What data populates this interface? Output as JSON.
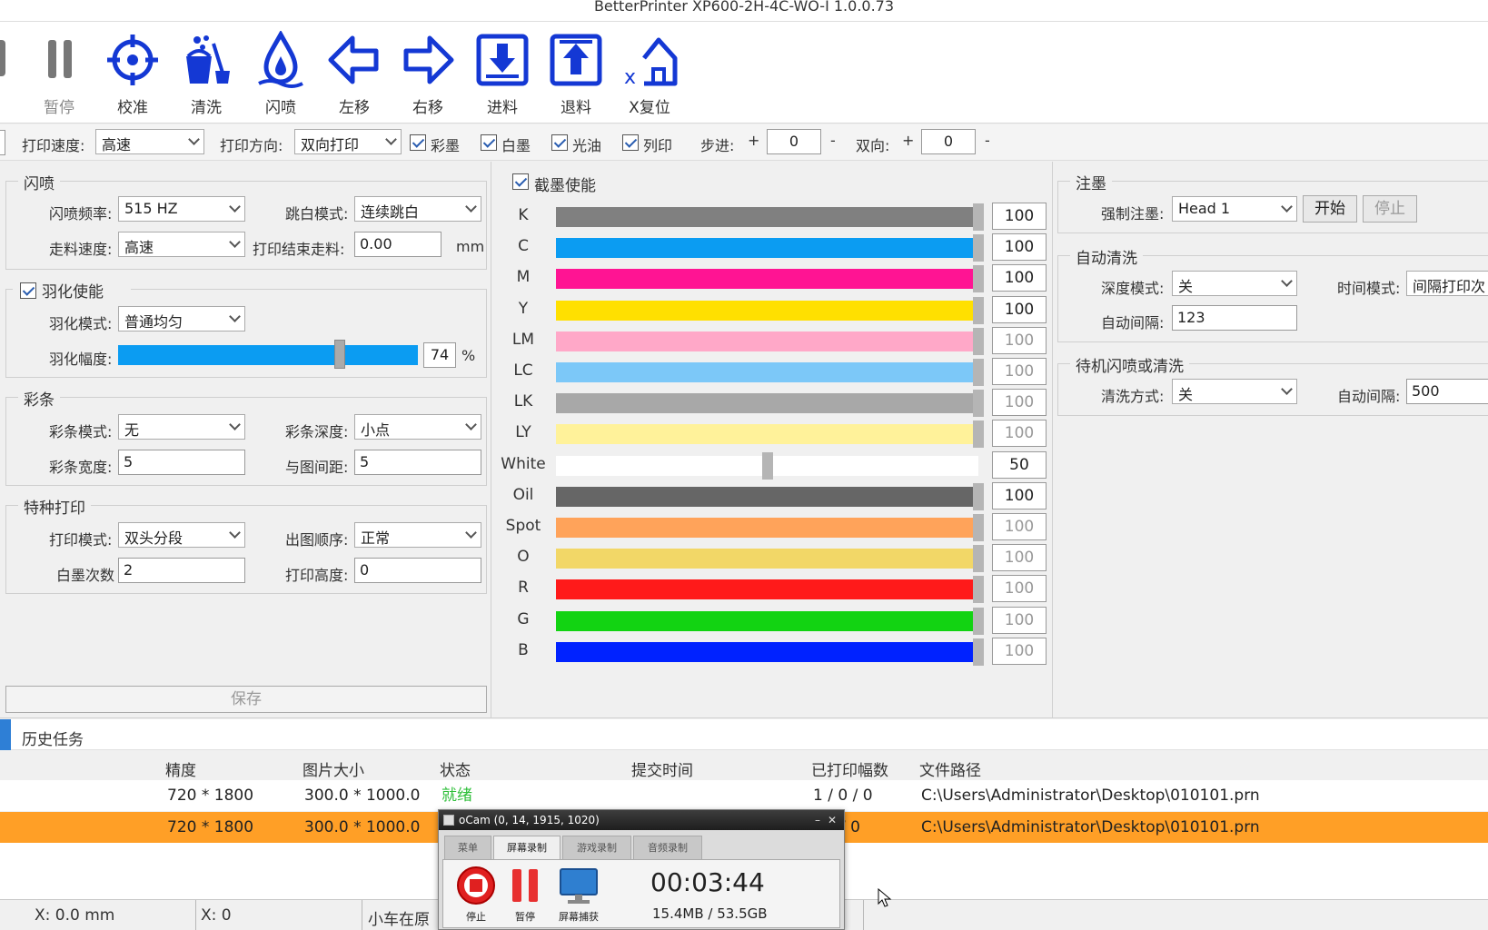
{
  "window": {
    "title": "BetterPrinter XP600-2H-4C-WO-I 1.0.0.73"
  },
  "toolbar": {
    "buttons": [
      {
        "label": "暂停",
        "icon": "pause-icon"
      },
      {
        "label": "校准",
        "icon": "crosshair-icon"
      },
      {
        "label": "清洗",
        "icon": "cleaning-bucket-icon"
      },
      {
        "label": "闪喷",
        "icon": "ink-drop-icon"
      },
      {
        "label": "左移",
        "icon": "arrow-left-icon"
      },
      {
        "label": "右移",
        "icon": "arrow-right-icon"
      },
      {
        "label": "进料",
        "icon": "feed-in-icon"
      },
      {
        "label": "退料",
        "icon": "feed-out-icon"
      },
      {
        "label": "X复位",
        "icon": "x-home-icon"
      }
    ]
  },
  "options": {
    "speed_label": "打印速度:",
    "speed_value": "高速",
    "direction_label": "打印方向:",
    "direction_value": "双向打印",
    "color_ink": "彩墨",
    "white_ink": "白墨",
    "varnish": "光油",
    "column_print": "列印",
    "step_label": "步进:",
    "step_plus": "+",
    "step_value": "0",
    "step_minus": "-",
    "bidir_label": "双向:",
    "bidir_plus": "+",
    "bidir_value": "0",
    "bidir_minus": "-"
  },
  "flash": {
    "title": "闪喷",
    "freq_label": "闪喷频率:",
    "freq_value": "515 HZ",
    "skip_label": "跳白模式:",
    "skip_value": "连续跳白",
    "move_speed_label": "走料速度:",
    "move_speed_value": "高速",
    "end_feed_label": "打印结束走料:",
    "end_feed_value": "0.00",
    "end_feed_unit": "mm"
  },
  "feather": {
    "title": "羽化使能",
    "mode_label": "羽化模式:",
    "mode_value": "普通均匀",
    "amp_label": "羽化幅度:",
    "amp_value": "74",
    "amp_unit": "%",
    "amp_fraction": 0.74
  },
  "strip": {
    "title": "彩条",
    "mode_label": "彩条模式:",
    "mode_value": "无",
    "depth_label": "彩条深度:",
    "depth_value": "小点",
    "width_label": "彩条宽度:",
    "width_value": "5",
    "gap_label": "与图间距:",
    "gap_value": "5"
  },
  "special": {
    "title": "特种打印",
    "mode_label": "打印模式:",
    "mode_value": "双头分段",
    "order_label": "出图顺序:",
    "order_value": "正常",
    "white_times_label": "白墨次数",
    "white_times_value": "2",
    "height_label": "打印高度:",
    "height_value": "0"
  },
  "save_label": "保存",
  "ink_limit": {
    "title": "截墨使能",
    "channels": [
      {
        "name": "K",
        "color": "#808080",
        "value": "100",
        "dim": false
      },
      {
        "name": "C",
        "color": "#0b9cf2",
        "value": "100",
        "dim": false
      },
      {
        "name": "M",
        "color": "#ff1493",
        "value": "100",
        "dim": false
      },
      {
        "name": "Y",
        "color": "#ffe000",
        "value": "100",
        "dim": false
      },
      {
        "name": "LM",
        "color": "#ffa8c8",
        "value": "100",
        "dim": true
      },
      {
        "name": "LC",
        "color": "#7cc8f8",
        "value": "100",
        "dim": true
      },
      {
        "name": "LK",
        "color": "#a8a8a8",
        "value": "100",
        "dim": true
      },
      {
        "name": "LY",
        "color": "#fff29a",
        "value": "100",
        "dim": true
      },
      {
        "name": "White",
        "color": "#ffffff",
        "value": "50",
        "dim": false
      },
      {
        "name": "Oil",
        "color": "#666666",
        "value": "100",
        "dim": false
      },
      {
        "name": "Spot",
        "color": "#ffa35a",
        "value": "100",
        "dim": true
      },
      {
        "name": "O",
        "color": "#f2d767",
        "value": "100",
        "dim": true
      },
      {
        "name": "R",
        "color": "#ff1a1a",
        "value": "100",
        "dim": true
      },
      {
        "name": "G",
        "color": "#12d312",
        "value": "100",
        "dim": true
      },
      {
        "name": "B",
        "color": "#0022ff",
        "value": "100",
        "dim": true
      }
    ]
  },
  "inject": {
    "title": "注墨",
    "force_label": "强制注墨:",
    "force_value": "Head 1",
    "start": "开始",
    "stop": "停止"
  },
  "auto_clean": {
    "title": "自动清洗",
    "depth_label": "深度模式:",
    "depth_value": "关",
    "time_label": "时间模式:",
    "time_value": "间隔打印次",
    "interval_label": "自动间隔:",
    "interval_value": "123"
  },
  "standby": {
    "title": "待机闪喷或清洗",
    "method_label": "清洗方式:",
    "method_value": "关",
    "interval_label": "自动间隔:",
    "interval_value": "500"
  },
  "history": {
    "tab": "历史任务",
    "columns": [
      "精度",
      "图片大小",
      "状态",
      "提交时间",
      "已打印幅数",
      "文件路径"
    ],
    "rows": [
      {
        "res": "720 * 1800",
        "size": "300.0 * 1000.0",
        "status": "就绪",
        "time": "",
        "printed": "1 / 0 / 0",
        "path": "C:\\Users\\Administrator\\Desktop\\010101.prn"
      },
      {
        "res": "720 * 1800",
        "size": "300.0 * 1000.0",
        "status": "",
        "time": "",
        "printed": "/ 0",
        "path": "C:\\Users\\Administrator\\Desktop\\010101.prn"
      }
    ]
  },
  "statusbar": {
    "pos_mm": "X: 0.0 mm",
    "pos": "X: 0",
    "carriage": "小车在原"
  },
  "ocam": {
    "title": "oCam (0, 14, 1915, 1020)",
    "tabs": [
      "菜单",
      "屏幕录制",
      "游戏录制",
      "音频录制"
    ],
    "stop": "停止",
    "pause": "暂停",
    "capture": "屏幕捕获",
    "timer": "00:03:44",
    "size": "15.4MB / 53.5GB"
  }
}
